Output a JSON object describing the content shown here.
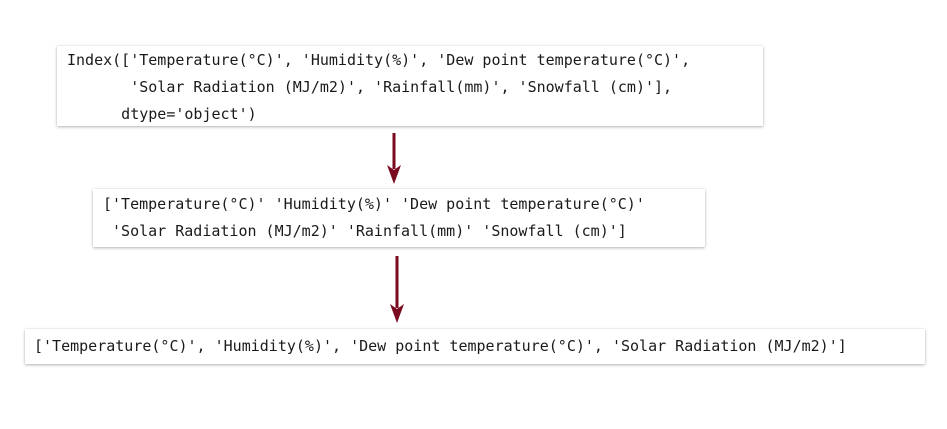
{
  "colors": {
    "arrow": "#7a0a1e",
    "text": "#1a1a1a",
    "box_background": "#ffffff"
  },
  "boxes": [
    {
      "lines": [
        "Index(['Temperature(°C)', 'Humidity(%)', 'Dew point temperature(°C)',",
        "       'Solar Radiation (MJ/m2)', 'Rainfall(mm)', 'Snowfall (cm)'],",
        "      dtype='object')"
      ]
    },
    {
      "lines": [
        "['Temperature(°C)' 'Humidity(%)' 'Dew point temperature(°C)'",
        " 'Solar Radiation (MJ/m2)' 'Rainfall(mm)' 'Snowfall (cm)']"
      ]
    },
    {
      "lines": [
        "['Temperature(°C)', 'Humidity(%)', 'Dew point temperature(°C)', 'Solar Radiation (MJ/m2)']"
      ]
    }
  ],
  "arrows": [
    {
      "icon": "arrow-down-icon",
      "from": "index-output-box",
      "to": "array-output-box"
    },
    {
      "icon": "arrow-down-icon",
      "from": "array-output-box",
      "to": "list-output-box"
    }
  ]
}
